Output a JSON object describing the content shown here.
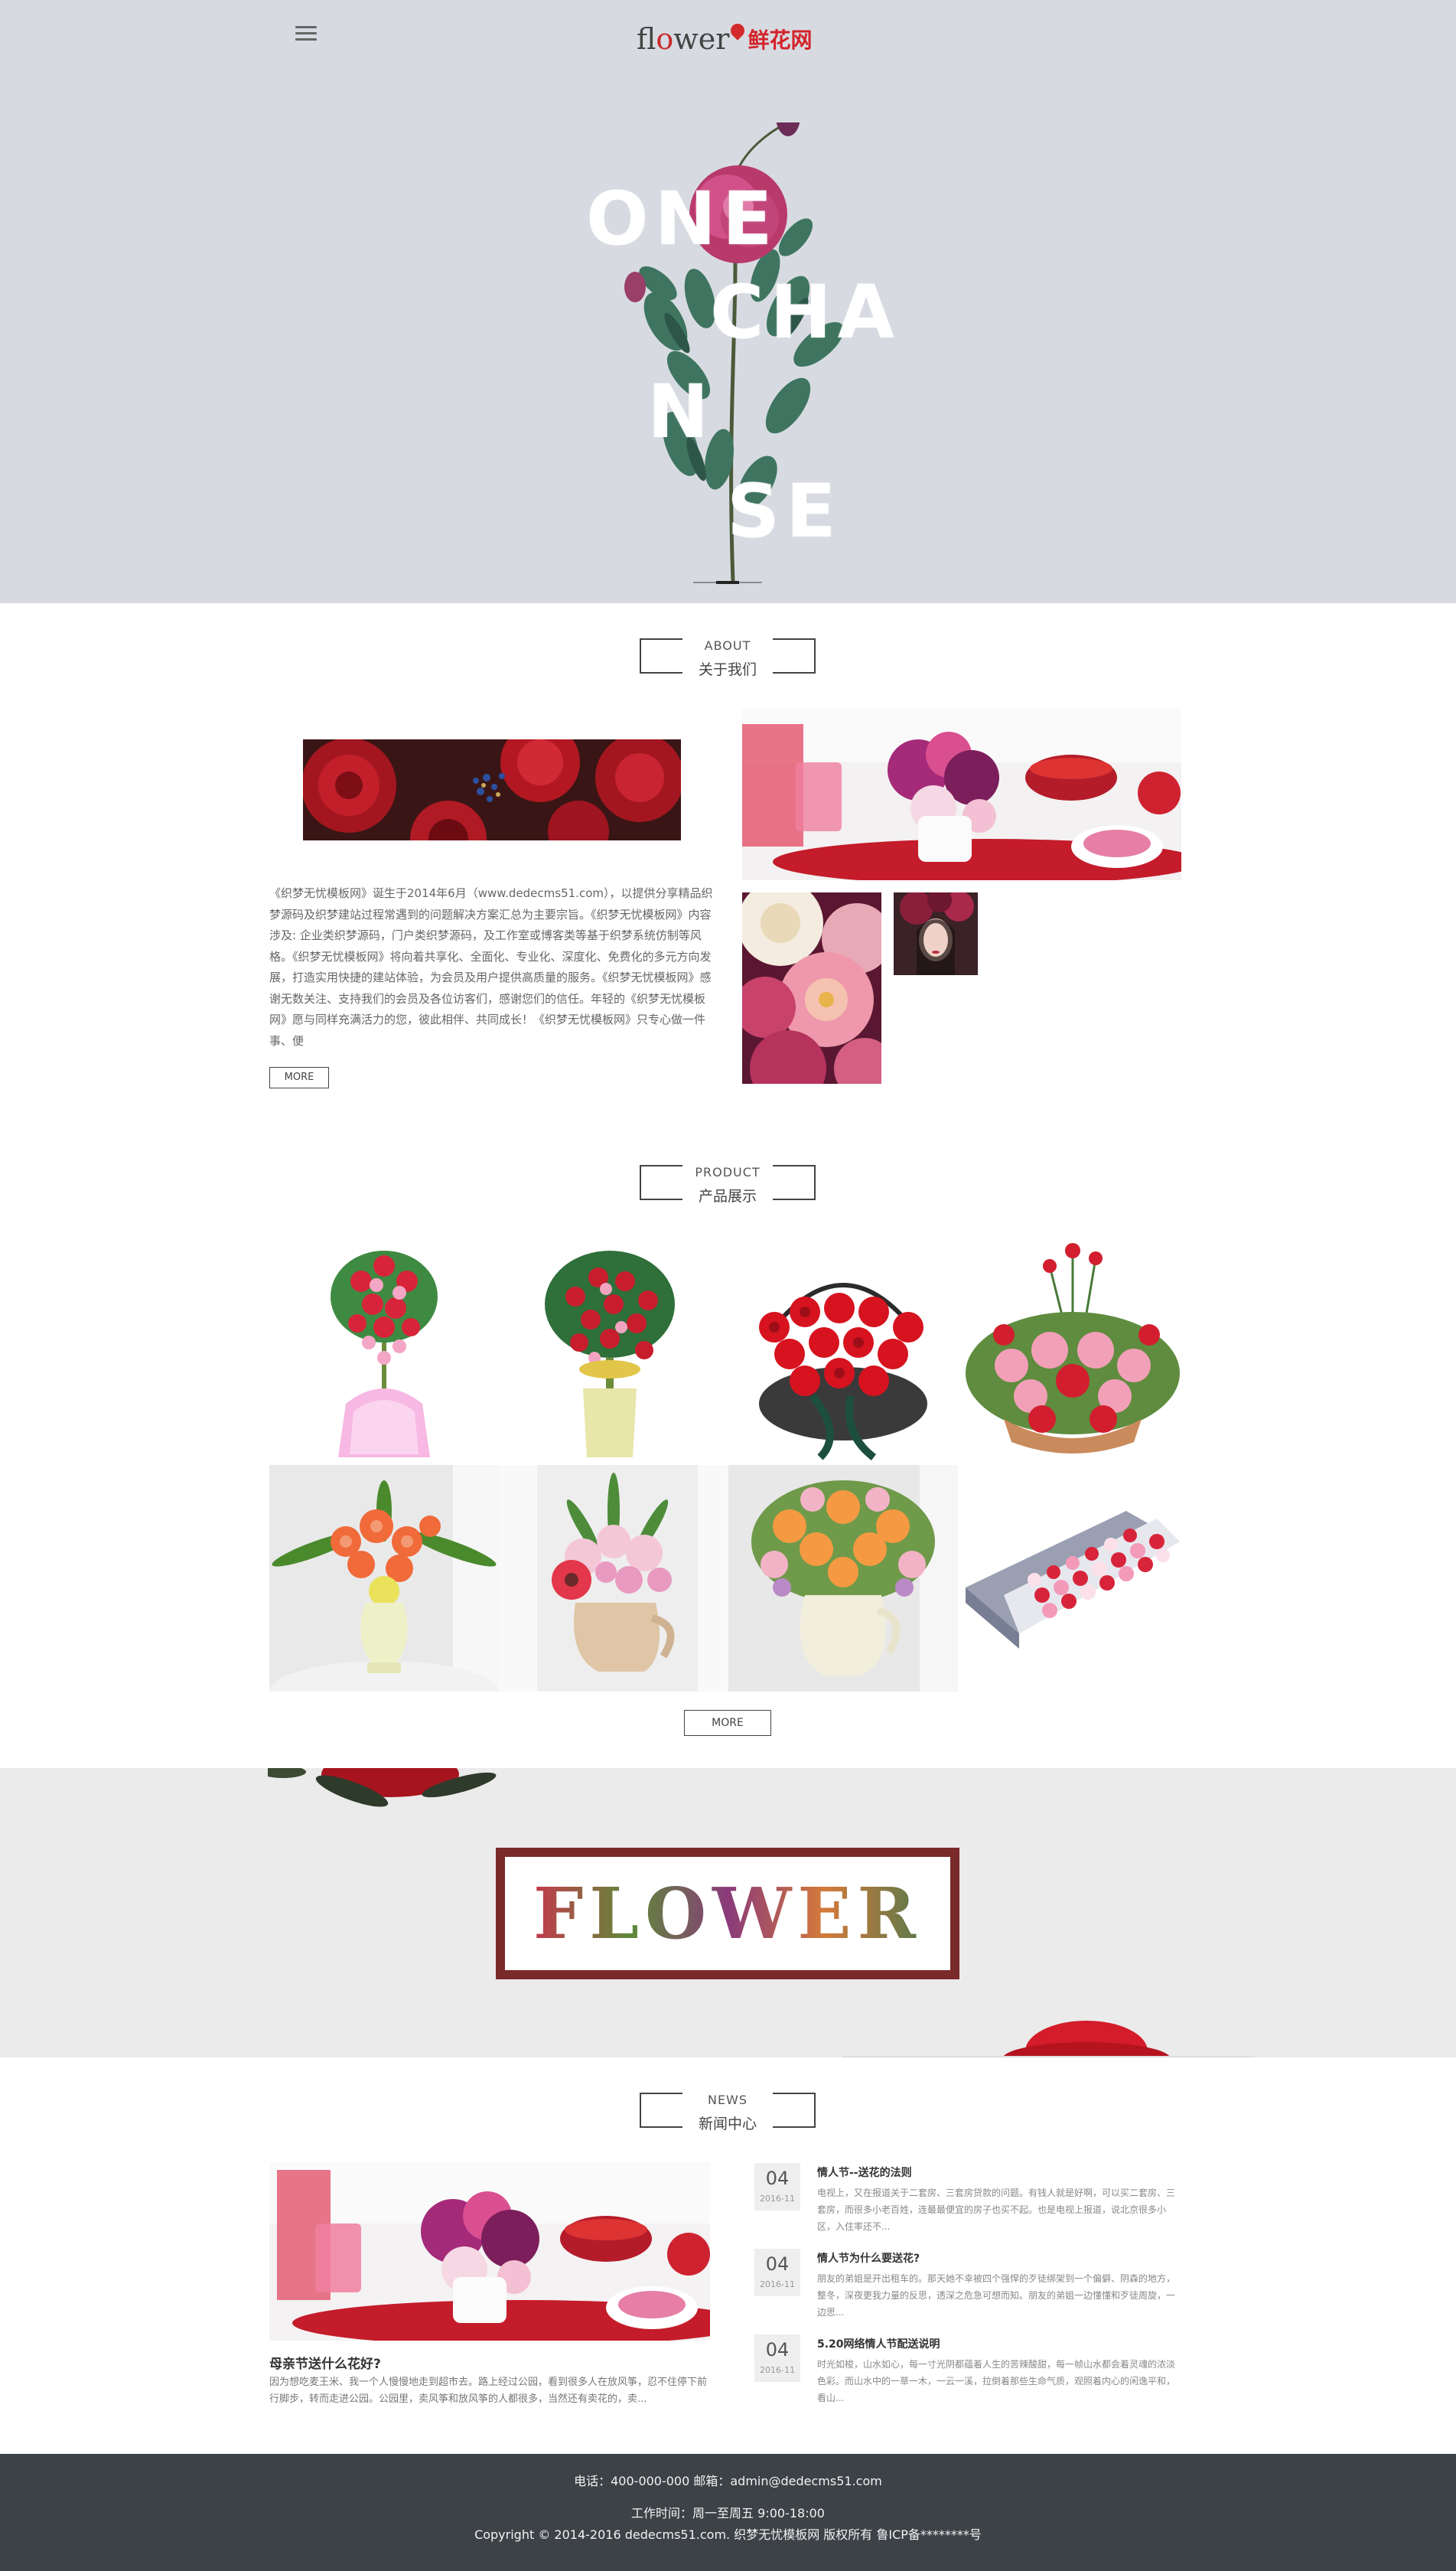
{
  "header": {
    "logo_en_prefix": "fl",
    "logo_en_o": "o",
    "logo_en_suffix": "wer",
    "logo_cn": "鲜花网"
  },
  "hero": {
    "letters": [
      "ONE",
      "CHA",
      "N",
      "SE"
    ]
  },
  "about": {
    "title_en": "ABOUT",
    "title_cn": "关于我们",
    "text": "《织梦无忧模板网》诞生于2014年6月（www.dedecms51.com），以提供分享精品织梦源码及织梦建站过程常遇到的问题解决方案汇总为主要宗旨。《织梦无忧模板网》内容涉及: 企业类织梦源码，门户类织梦源码，及工作室或博客类等基于织梦系统仿制等风格。《织梦无忧模板网》将向着共享化、全面化、专业化、深度化、免费化的多元方向发展，打造实用快捷的建站体验，为会员及用户提供高质量的服务。《织梦无忧模板网》感谢无数关注、支持我们的会员及各位访客们，感谢您们的信任。年轻的《织梦无忧模板网》愿与同样充满活力的您，彼此相伴、共同成长！《织梦无忧模板网》只专心做一件事、便",
    "more": "MORE"
  },
  "product": {
    "title_en": "PRODUCT",
    "title_cn": "产品展示",
    "more": "MORE"
  },
  "banner": {
    "word": "FLOWER"
  },
  "news": {
    "title_en": "NEWS",
    "title_cn": "新闻中心",
    "main": {
      "title": "母亲节送什么花好?",
      "desc": "因为想吃麦王米、我一个人慢慢地走到超市去。路上经过公园，看到很多人在放风筝，忍不住停下前行脚步，转而走进公园。公园里，卖风筝和放风筝的人都很多，当然还有卖花的，卖..."
    },
    "items": [
      {
        "day": "04",
        "ym": "2016-11",
        "title": "情人节--送花的法则",
        "summary": "电视上，又在报道关于二套房、三套房贷款的问题。有钱人就是好啊，可以买二套房、三套房，而很多小老百姓，连最最便宜的房子也买不起。也是电视上报道，说北京很多小区，入住率还不..."
      },
      {
        "day": "04",
        "ym": "2016-11",
        "title": "情人节为什么要送花?",
        "summary": "朋友的弟姐是开出租车的。那天她不幸被四个强悍的歹徒绑架到一个偏僻、阴森的地方，整冬，深夜更我力量的反思，透深之危急可想而知。朋友的弟姐一边懂懂和歹徒周旋，一边思..."
      },
      {
        "day": "04",
        "ym": "2016-11",
        "title": "5.20网络情人节配送说明",
        "summary": "时光如梭，山水如心，每一寸光阴都蕴着人生的苦辣酸甜，每一帧山水都会着灵魂的浓淡色彩。而山水中的一草一木，一云一溪，拉倒着那些生命气质，观照着内心的闲逸平和，看山..."
      }
    ]
  },
  "footer": {
    "contact": "电话：400-000-000      邮箱：admin@dedecms51.com",
    "hours": "工作时间：周一至周五 9:00-18:00",
    "copyright": "Copyright © 2014-2016 dedecms51.com. 织梦无忧模板网 版权所有     鲁ICP备********号"
  },
  "colors": {
    "hero_bg": "#d7dbe1",
    "footer_bg": "#3d4247",
    "brand_red": "#d3232a"
  }
}
